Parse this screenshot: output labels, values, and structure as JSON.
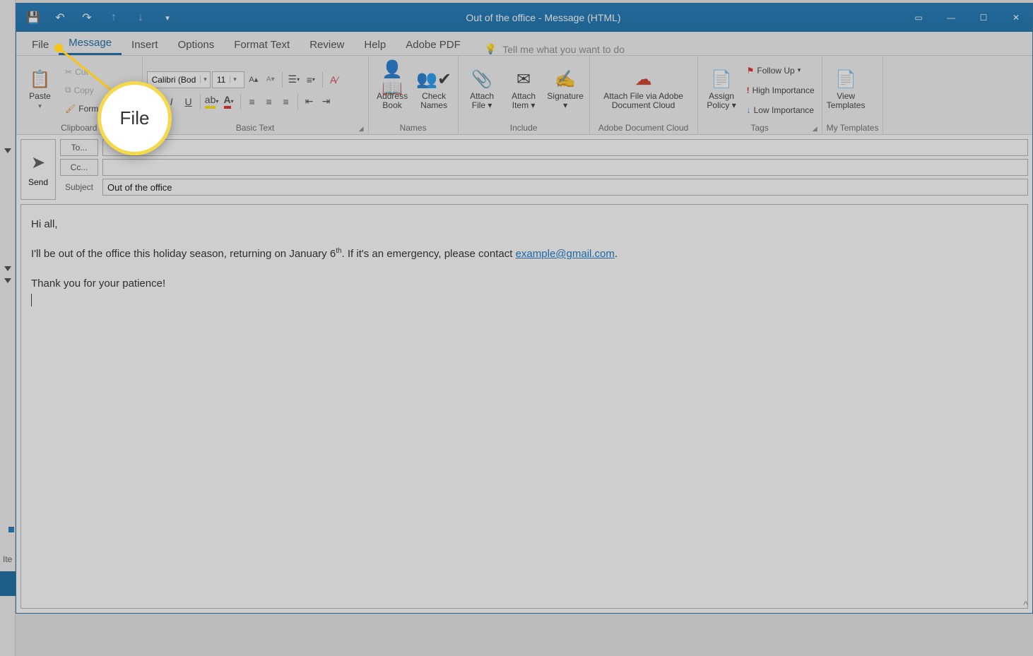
{
  "title_bar": {
    "title": "Out of the office  -  Message (HTML)"
  },
  "tabs": {
    "file": "File",
    "message": "Message",
    "insert": "Insert",
    "options": "Options",
    "format_text": "Format Text",
    "review": "Review",
    "help": "Help",
    "adobe_pdf": "Adobe PDF",
    "tell_me": "Tell me what you want to do"
  },
  "ribbon": {
    "clipboard": {
      "label": "Clipboard",
      "paste": "Paste",
      "cut": "Cut",
      "copy": "Copy",
      "format_painter": "Format Painter"
    },
    "basic_text": {
      "label": "Basic Text",
      "font_name": "Calibri (Bod",
      "font_size": "11"
    },
    "names": {
      "label": "Names",
      "address_book": "Address Book",
      "check_names": "Check Names"
    },
    "include": {
      "label": "Include",
      "attach_file": "Attach File",
      "attach_item": "Attach Item",
      "signature": "Signature"
    },
    "adobe": {
      "label": "Adobe Document Cloud",
      "attach_via": "Attach File via Adobe Document Cloud"
    },
    "tags": {
      "label": "Tags",
      "assign_policy": "Assign Policy",
      "follow_up": "Follow Up",
      "high_importance": "High Importance",
      "low_importance": "Low Importance"
    },
    "templates": {
      "label": "My Templates",
      "view_templates": "View Templates"
    }
  },
  "compose": {
    "send": "Send",
    "to": "To...",
    "cc": "Cc...",
    "subject_label": "Subject",
    "subject_value": "Out of the office",
    "body": {
      "greeting": "Hi all,",
      "line1_a": "I'll be out of the office this holiday season, returning on January 6",
      "line1_sup": "th",
      "line1_b": ". If it's an emergency, please contact ",
      "email": "example@gmail.com",
      "line1_c": ".",
      "thanks": "Thank you for your patience!"
    }
  },
  "highlight": {
    "text": "File"
  },
  "backdrop": {
    "items_label": "Ite"
  }
}
